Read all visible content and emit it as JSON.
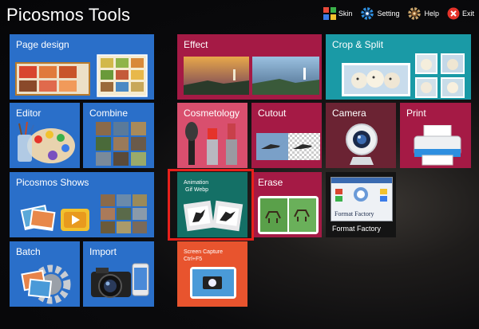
{
  "app": {
    "title": "Picosmos Tools"
  },
  "topbar": {
    "skin": "Skin",
    "setting": "Setting",
    "help": "Help",
    "exit": "Exit"
  },
  "tiles": {
    "page_design": "Page design",
    "editor": "Editor",
    "combine": "Combine",
    "shows": "Picosmos Shows",
    "batch": "Batch",
    "import": "Import",
    "effect": "Effect",
    "crop_split": "Crop & Split",
    "cosmetology": "Cosmetology",
    "cutout": "Cutout",
    "camera": "Camera",
    "print": "Print",
    "animation_line1": "Animation",
    "animation_line2": "Gif Webp",
    "erase": "Erase",
    "format_factory": "Format Factory",
    "ff_logo_text": "Format Factory",
    "screen_capture_line1": "Screen Capture",
    "screen_capture_line2": "Ctrl+F5"
  },
  "colors": {
    "blue": "#2a6fc9",
    "crimson": "#a51a45",
    "teal": "#1a9aa6",
    "pink": "#d94f6e",
    "maroon": "#6b2333",
    "green": "#147066",
    "orange": "#e8542e",
    "highlight": "#e8201b"
  }
}
